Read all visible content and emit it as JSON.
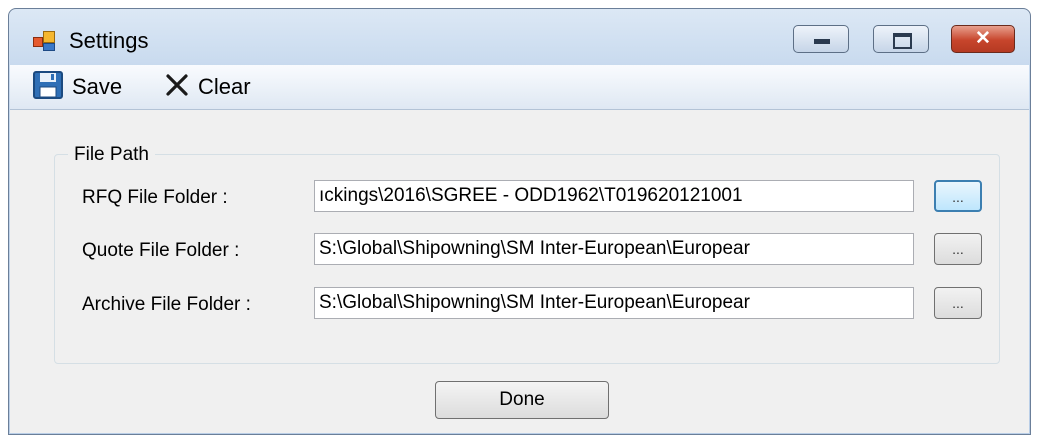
{
  "window": {
    "title": "Settings"
  },
  "toolbar": {
    "save_label": "Save",
    "clear_label": "Clear",
    "save_icon": "floppy-disk-icon",
    "clear_icon": "x-icon"
  },
  "file_path_group": {
    "title": "File Path",
    "rows": [
      {
        "label": "RFQ File Folder :",
        "value": "ıckings\\2016\\SGREE - ODD1962\\T019620121001",
        "browse_label": "..."
      },
      {
        "label": "Quote File Folder :",
        "value": "S:\\Global\\Shipowning\\SM Inter-European\\Europear",
        "browse_label": "..."
      },
      {
        "label": "Archive File Folder :",
        "value": "S:\\Global\\Shipowning\\SM Inter-European\\Europear",
        "browse_label": "..."
      }
    ]
  },
  "done_label": "Done",
  "colors": {
    "close_button": "#c7452c",
    "focus_border": "#3c7fb1"
  }
}
